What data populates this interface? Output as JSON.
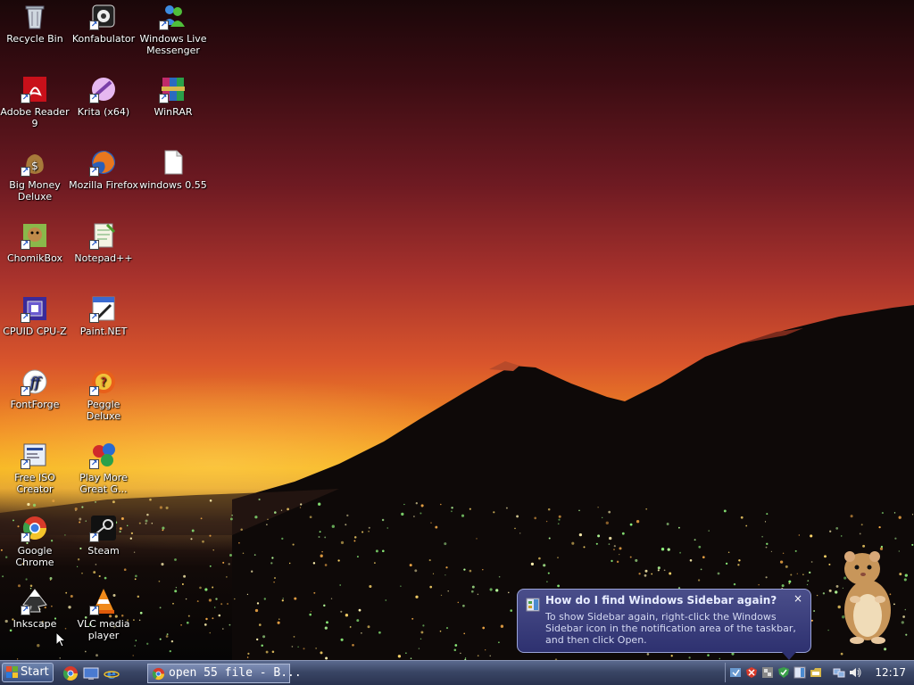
{
  "desktop": {
    "icons": [
      {
        "label": "Recycle Bin",
        "icon": "recycle-bin-icon"
      },
      {
        "label": "Konfabulator",
        "icon": "konfabulator-icon"
      },
      {
        "label": "Windows Live Messenger",
        "icon": "messenger-icon"
      },
      {
        "label": "Adobe Reader 9",
        "icon": "adobe-reader-icon"
      },
      {
        "label": "Krita (x64)",
        "icon": "krita-icon"
      },
      {
        "label": "WinRAR",
        "icon": "winrar-icon"
      },
      {
        "label": "Big Money Deluxe",
        "icon": "big-money-icon"
      },
      {
        "label": "Mozilla Firefox",
        "icon": "firefox-icon"
      },
      {
        "label": "windows 0.55",
        "icon": "file-icon"
      },
      {
        "label": "ChomikBox",
        "icon": "chomikbox-icon"
      },
      {
        "label": "Notepad++",
        "icon": "notepad-plus-icon"
      },
      {
        "label": "CPUID CPU-Z",
        "icon": "cpu-z-icon"
      },
      {
        "label": "Paint.NET",
        "icon": "paint-net-icon"
      },
      {
        "label": "FontForge",
        "icon": "fontforge-icon"
      },
      {
        "label": "Peggle Deluxe",
        "icon": "peggle-icon"
      },
      {
        "label": "Free ISO Creator",
        "icon": "iso-creator-icon"
      },
      {
        "label": "Play More Great G...",
        "icon": "games-icon"
      },
      {
        "label": "Google Chrome",
        "icon": "chrome-icon"
      },
      {
        "label": "Steam",
        "icon": "steam-icon"
      },
      {
        "label": "Inkscape",
        "icon": "inkscape-icon"
      },
      {
        "label": "VLC media player",
        "icon": "vlc-icon"
      }
    ]
  },
  "balloon": {
    "title": "How do I find Windows Sidebar again?",
    "body": "To show Sidebar again, right-click the Windows Sidebar icon in the notification area of the taskbar, and then click Open.",
    "close": "×"
  },
  "taskbar": {
    "start_label": "Start",
    "quick_launch": [
      "chrome-icon",
      "show-desktop-icon",
      "internet-explorer-icon"
    ],
    "task_button": "open 55 file - B...",
    "tray_icons": [
      "security-shield-icon",
      "warning-icon",
      "network-monitor-icon",
      "defender-icon",
      "sidebar-icon",
      "folder-icon",
      "network-icon",
      "volume-icon"
    ],
    "clock": "12:17"
  },
  "colors": {
    "taskbar": "#3a4665",
    "balloon": "#2e3170",
    "sky_top": "#1a0709",
    "sky_horizon": "#f6b51c"
  }
}
